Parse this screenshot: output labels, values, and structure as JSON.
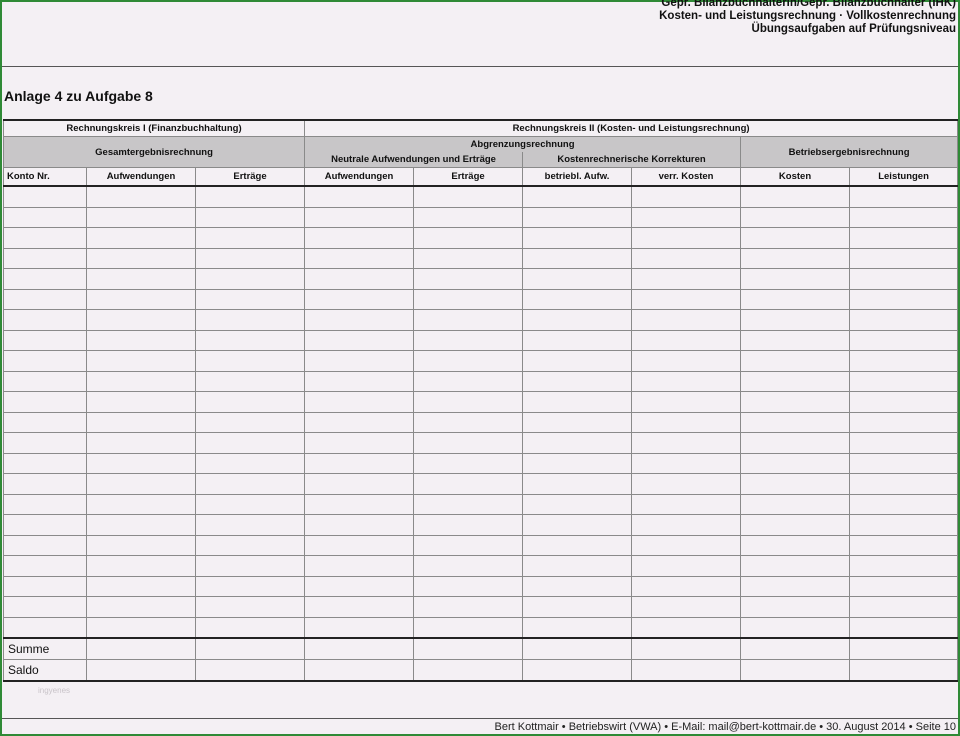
{
  "header": {
    "line1": "Gepr.  Bilanzbuchhalterin/Gepr. Bilanzbuchhalter (IHK)",
    "line2": "Kosten- und Leistungsrechnung · Vollkostenrechnung",
    "line3": "Übungsaufgaben auf Prüfungsniveau"
  },
  "title": "Anlage 4 zu Aufgabe 8",
  "table": {
    "rk1": "Rechnungskreis I (Finanzbuchhaltung)",
    "rk2": "Rechnungskreis II (Kosten- und Leistungsrechnung)",
    "gesamt": "Gesamtergebnisrechnung",
    "abgrenzung": "Abgrenzungsrechnung",
    "neutrale": "Neutrale Aufwendungen und Erträge",
    "korrekturen": "Kostenrechnerische Korrekturen",
    "betrieb": "Betriebsergebnisrechnung",
    "columns": [
      "Konto Nr.",
      "Aufwendungen",
      "Erträge",
      "Aufwendungen",
      "Erträge",
      "betriebl. Aufw.",
      "verr. Kosten",
      "Kosten",
      "Leistungen"
    ],
    "summe": "Summe",
    "saldo": "Saldo"
  },
  "watermark": "ingyenes",
  "footer": "Bert Kottmair  • Betriebswirt (VWA)  • E-Mail: mail@bert-kottmair.de  • 30. August 2014  • Seite 10"
}
